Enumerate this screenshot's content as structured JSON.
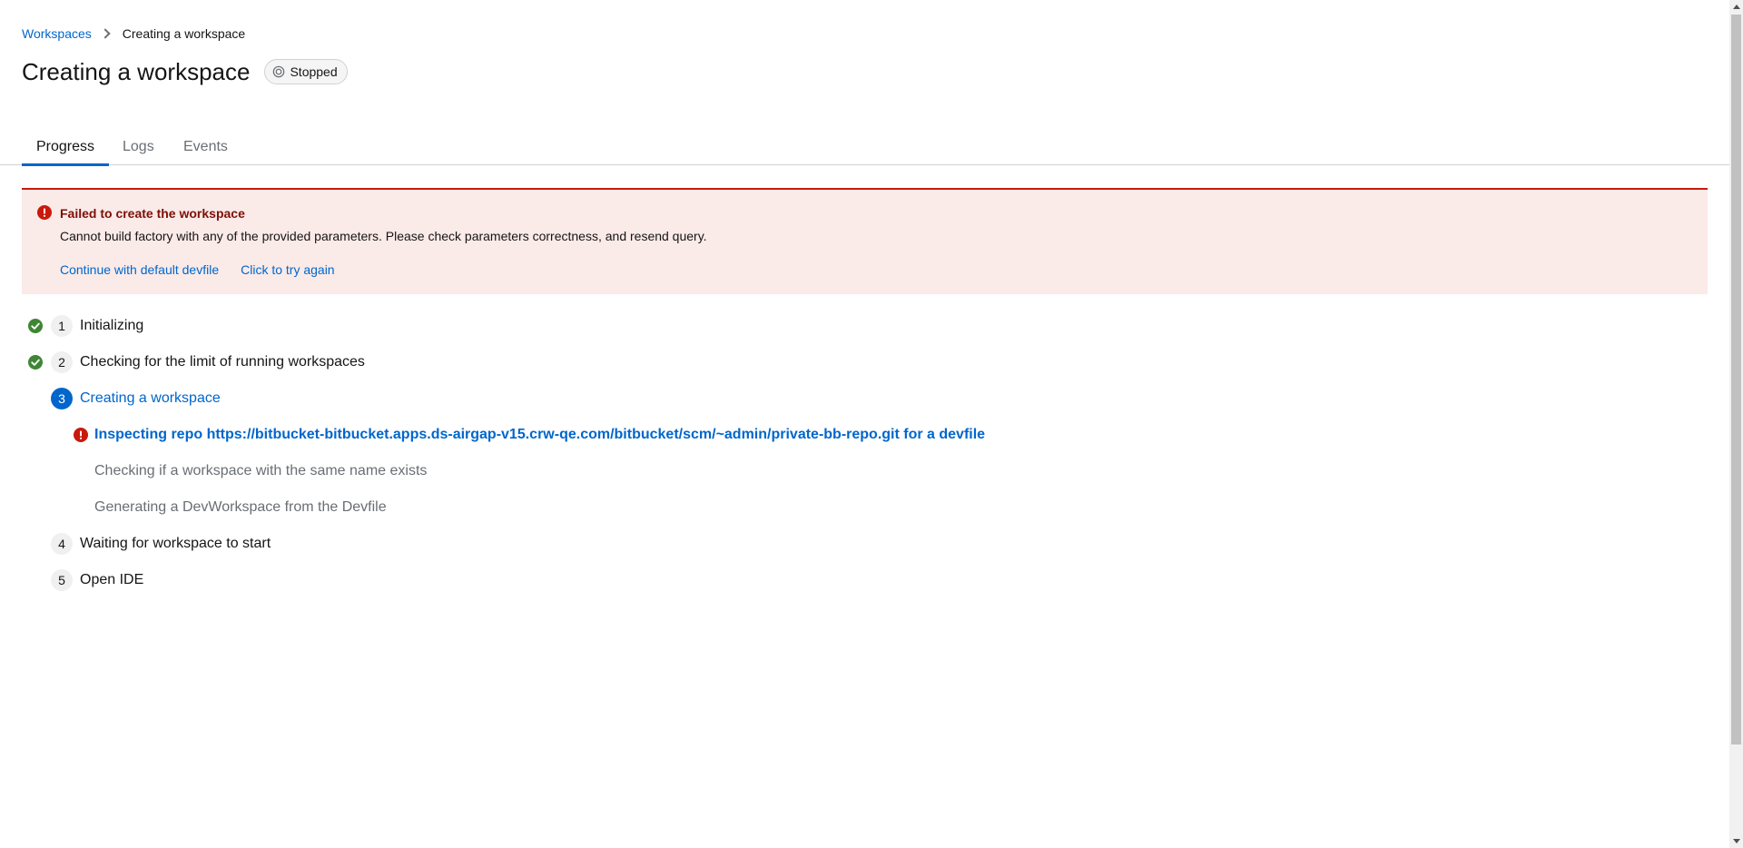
{
  "breadcrumb": {
    "root_label": "Workspaces",
    "current_label": "Creating a workspace"
  },
  "header": {
    "title": "Creating a workspace",
    "status": "Stopped"
  },
  "tabs": [
    {
      "label": "Progress",
      "active": true
    },
    {
      "label": "Logs",
      "active": false
    },
    {
      "label": "Events",
      "active": false
    }
  ],
  "alert": {
    "title": "Failed to create the workspace",
    "description": "Cannot build factory with any of the provided parameters. Please check parameters correctness, and resend query.",
    "actions": [
      "Continue with default devfile",
      "Click to try again"
    ]
  },
  "steps": [
    {
      "number": "1",
      "label": "Initializing",
      "state": "done"
    },
    {
      "number": "2",
      "label": "Checking for the limit of running workspaces",
      "state": "done"
    },
    {
      "number": "3",
      "label": "Creating a workspace",
      "state": "current",
      "substeps": [
        {
          "label": "Inspecting repo https://bitbucket-bitbucket.apps.ds-airgap-v15.crw-qe.com/bitbucket/scm/~admin/private-bb-repo.git for a devfile",
          "state": "error"
        },
        {
          "label": "Checking if a workspace with the same name exists",
          "state": "pending"
        },
        {
          "label": "Generating a DevWorkspace from the Devfile",
          "state": "pending"
        }
      ]
    },
    {
      "number": "4",
      "label": "Waiting for workspace to start",
      "state": "pending"
    },
    {
      "number": "5",
      "label": "Open IDE",
      "state": "pending"
    }
  ],
  "colors": {
    "link": "#0066cc",
    "danger": "#c9190b",
    "success": "#3e8635",
    "alert_bg": "#faeae8"
  },
  "icons": {
    "status": "stopped-circle-icon",
    "alert": "exclamation-circle-icon",
    "done": "check-circle-icon"
  }
}
